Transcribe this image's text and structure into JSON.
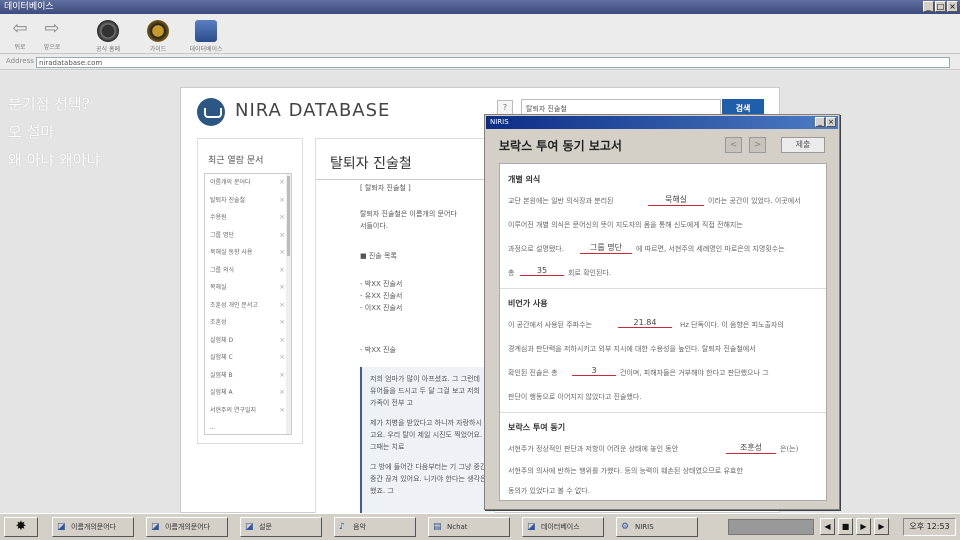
{
  "window": {
    "title": "데이터베이스"
  },
  "toolbar": {
    "back": "뒤로",
    "forward": "앞으로",
    "btn1": "공식 홈페",
    "btn2": "가이드",
    "btn3": "데이터베이스"
  },
  "address": {
    "label": "Address",
    "value": "niradatabase.com"
  },
  "notes": [
    "분기점 선택?",
    "오 설마",
    "왜 아냐 왜아냐"
  ],
  "site": {
    "title": "NIRA DATABASE",
    "help": "?",
    "search_value": "탈퇴자 진술철",
    "search_button": "검색"
  },
  "recent": {
    "title": "최근 열람 문서",
    "items": [
      "이름개의 문어다",
      "탈퇴자 진술철",
      "수용원",
      "그룹 명단",
      "묵해실 동향 사용",
      "그룹 의식",
      "목해실",
      "조훈성 개인 문서고",
      "조훈성",
      "실험체 D",
      "실험체 C",
      "실험체 B",
      "실험체 A",
      "서현주의 연구일지",
      "..."
    ]
  },
  "main": {
    "title": "탈퇴자 진술철",
    "tag": "[ 탈퇴자 진술철 ]",
    "desc1": "탈퇴자 진술철은 이름개의 문어다",
    "desc2": "서들이다.",
    "list_head": "■ 진술 목록",
    "list": [
      "- 박XX 진술서",
      "- 유XX 진술서",
      "- 이XX 진술서"
    ],
    "statement_head": "- 박XX 진술",
    "quote": [
      "저희 엄마가 많이 아프셨죠. 그 그런데 유어들을 드시고 두 달 그걸 보고 저희 가족이 전부 고",
      "제가 치병을 받았다고 하니까 자랑하시고요. 우리 탈이 제일 시진도 찍었어요. 그때는 치료",
      "그 방에 들어간 다음부터는 기 그냥 중간중간 끊겨 있어요. 니가야 한다는 생각은 했죠. 그"
    ]
  },
  "niris": {
    "window_title": "NIRIS",
    "title": "보락스 투여 동기 보고서",
    "prev": "<",
    "next": ">",
    "submit": "제출",
    "sec1": {
      "head": "개별 의식",
      "l1a": "교단 본원에는 일반 의식장과 분리된",
      "b1": "묵해실",
      "l1b": "이라는 공간이 있었다. 이곳에서",
      "l2": "이루어진 개별 의식은 문어신의 뜻이 지도자의 몸을 통해 신도에게 직접 전해지는",
      "l3a": "과정으로 설명됐다.",
      "b2": "그룹 명단",
      "l3b": "에 따르면, 서현주의 세례명인 마로은의 지명횟수는",
      "l4a": "총",
      "b3": "35",
      "l4b": "회로 확인된다."
    },
    "sec2": {
      "head": "비언가 사용",
      "l1a": "이 공간에서 사용된 주파수는",
      "b1": "21.84",
      "l1b": "Hz 단독이다. 이 음향은 피노출자의",
      "l2": "경계심과 판단력을 저하시키고 외부 지시에 대한 수용성을 높인다. 탈퇴자 진술철에서",
      "l3a": "확인된 진술은 총",
      "b2": "3",
      "l3b": "건이며, 피해자들은 거부해야 한다고 판단했으나 그",
      "l4": "판단이 행동으로 이어지지 않았다고 진술했다."
    },
    "sec3": {
      "head": "보락스 투여 동기",
      "l1a": "서현주가 정상적인 판단과 저항이 어려운 상태에 놓인 동안",
      "b1": "조훈성",
      "l1b": "은(는)",
      "l2": "서현주의 의사에 반하는 행위를 가했다. 등의 능력이 훼손된 상태였으므로 유효한",
      "l3": "동의가 있었다고 볼 수 없다."
    }
  },
  "taskbar": {
    "tasks": [
      "이름개의문어다",
      "이름개의문어다",
      "설문",
      "음악",
      "Nchat",
      "데이터베이스",
      "NIRIS"
    ],
    "clock": "오후 12:53"
  }
}
